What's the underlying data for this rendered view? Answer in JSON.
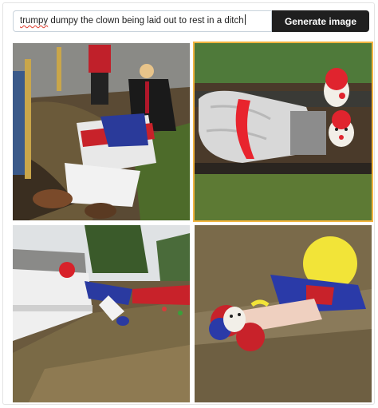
{
  "prompt": {
    "misspelled_word": "trumpy",
    "rest_text": " dumpy the clown being laid out to rest in a ditch",
    "placeholder": ""
  },
  "generate_button": {
    "label": "Generate image"
  },
  "results": [
    {
      "id": "result-image-1",
      "description": "clown in striped costume lying in a grassy ditch beside a road while people in suits look on"
    },
    {
      "id": "result-image-2",
      "description": "large clown figure with white face and red hair lying in a ditch"
    },
    {
      "id": "result-image-3",
      "description": "clown lying on dirt slope beside a white concrete barrier"
    },
    {
      "id": "result-image-4",
      "description": "clown with yellow and blue hair lying on dirt ground"
    }
  ],
  "colors": {
    "button_bg": "#1f1f1f",
    "button_text": "#ffffff",
    "input_border": "#c9d3dc",
    "selected_outline": "#f2b440",
    "spellcheck_underline": "#e0392b"
  }
}
